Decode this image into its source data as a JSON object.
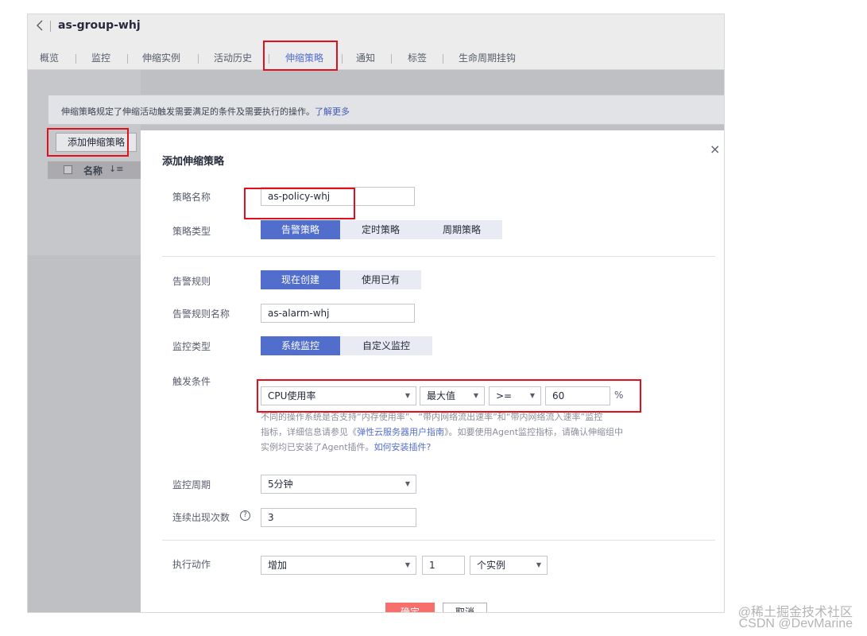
{
  "header": {
    "group_title": "as-group-whj",
    "tabs": [
      "概览",
      "监控",
      "伸缩实例",
      "活动历史",
      "伸缩策略",
      "通知",
      "标签",
      "生命周期挂钩"
    ],
    "active_tab": "伸缩策略"
  },
  "page": {
    "info_text": "伸缩策略规定了伸缩活动触发需要满足的条件及需要执行的操作。",
    "info_link": "了解更多",
    "add_policy_label": "添加伸缩策略",
    "column_name": "名称",
    "sort_glyph": "↓≡"
  },
  "dialog": {
    "title": "添加伸缩策略",
    "close_glyph": "×",
    "policy_name_label": "策略名称",
    "policy_name_value": "as-policy-whj",
    "policy_type_label": "策略类型",
    "policy_types": [
      "告警策略",
      "定时策略",
      "周期策略"
    ],
    "alarm_rule_label": "告警规则",
    "alarm_rule_options": [
      "现在创建",
      "使用已有"
    ],
    "alarm_rule_name_label": "告警规则名称",
    "alarm_rule_name_value": "as-alarm-whj",
    "monitor_type_label": "监控类型",
    "monitor_types": [
      "系统监控",
      "自定义监控"
    ],
    "trigger_label": "触发条件",
    "trigger_metric": "CPU使用率",
    "trigger_stat": "最大值",
    "trigger_operator": ">=",
    "trigger_value": "60",
    "trigger_unit": "%",
    "hint_line1": "不同的操作系统是否支持“内存使用率”、“带内网络流出速率”和“带内网络流入速率”监控",
    "hint_line2_a": "指标，详细信息请参见《",
    "hint_line2_link": "弹性云服务器用户指南",
    "hint_line2_b": "》。如要使用Agent监控指标，请确认伸缩组中",
    "hint_line3_a": "实例均已安装了Agent插件。",
    "hint_line3_link": "如何安装插件?",
    "period_label": "监控周期",
    "period_value": "5分钟",
    "count_label": "连续出现次数",
    "count_help": "?",
    "count_value": "3",
    "action_label": "执行动作",
    "action_type": "增加",
    "action_amount": "1",
    "action_unit": "个实例",
    "ok_label": "确定",
    "cancel_label": "取消",
    "caret": "▼"
  },
  "watermark": {
    "line1": "@稀土掘金技术社区",
    "line2": "CSDN @DevMarine"
  }
}
